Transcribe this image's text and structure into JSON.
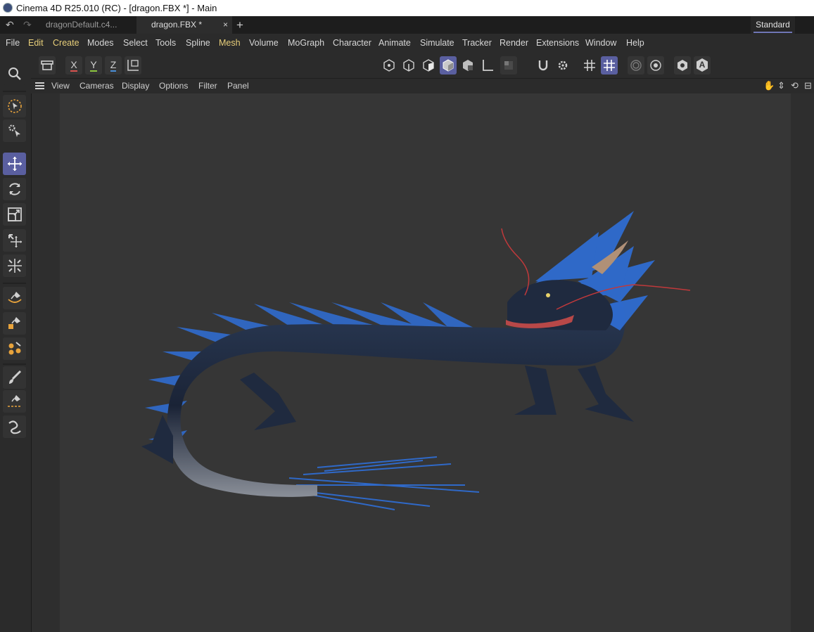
{
  "window": {
    "title": "Cinema 4D R25.010 (RC) - [dragon.FBX *] - Main"
  },
  "tabs": [
    {
      "label": "dragonDefault.c4..."
    },
    {
      "label": "dragon.FBX *",
      "close": "×"
    }
  ],
  "layout": {
    "label": "Standard"
  },
  "menu": [
    "File",
    "Edit",
    "Create",
    "Modes",
    "Select",
    "Tools",
    "Spline",
    "Mesh",
    "Volume",
    "MoGraph",
    "Character",
    "Animate",
    "Simulate",
    "Tracker",
    "Render",
    "Extensions",
    "Window",
    "Help"
  ],
  "toolbar": {
    "axis_x": "X",
    "axis_y": "Y",
    "axis_z": "Z",
    "text_tool": "A"
  },
  "viewport_menu": [
    "View",
    "Cameras",
    "Display",
    "Options",
    "Filter",
    "Panel"
  ],
  "colors": {
    "accent": "#5a5fa0",
    "menu_highlight": "#e8cf7a",
    "axis_x": "#d9534f",
    "axis_y": "#8dc63f",
    "axis_z": "#4a90d9",
    "dragon_body": "#1f2a3f",
    "dragon_fur": "#2f6fd8"
  },
  "icons": {
    "undo": "undo-icon",
    "redo": "redo-icon",
    "new_tab": "plus-icon",
    "search": "search-icon",
    "hand": "hand-icon",
    "move_view": "move-view-icon",
    "rotate_view": "rotate-view-icon",
    "maximize": "maximize-icon"
  }
}
